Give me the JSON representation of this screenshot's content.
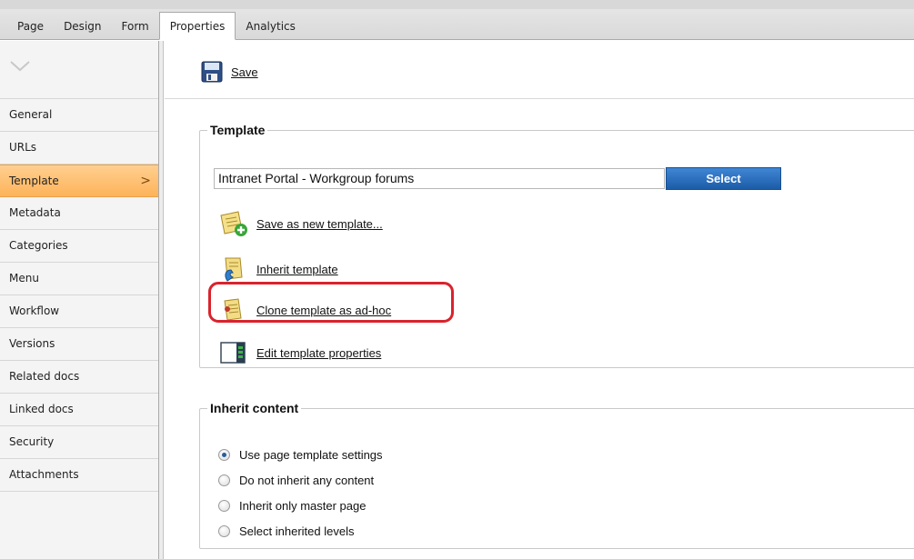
{
  "tabs": [
    {
      "label": "Page"
    },
    {
      "label": "Design"
    },
    {
      "label": "Form"
    },
    {
      "label": "Properties",
      "active": true
    },
    {
      "label": "Analytics"
    }
  ],
  "sidebar": {
    "collapse_icon": "chevron-down-icon",
    "items": [
      {
        "label": "General"
      },
      {
        "label": "URLs"
      },
      {
        "label": "Template",
        "active": true,
        "chevron": ">"
      },
      {
        "label": "Metadata"
      },
      {
        "label": "Categories"
      },
      {
        "label": "Menu"
      },
      {
        "label": "Workflow"
      },
      {
        "label": "Versions"
      },
      {
        "label": "Related docs"
      },
      {
        "label": "Linked docs"
      },
      {
        "label": "Security"
      },
      {
        "label": "Attachments"
      }
    ]
  },
  "toolbar": {
    "save_label": "Save",
    "save_icon": "floppy-disk-icon"
  },
  "template_section": {
    "title": "Template",
    "current_template": "Intranet Portal - Workgroup forums",
    "select_label": "Select",
    "actions": [
      {
        "label": "Save as new template...",
        "icon": "save-template-icon"
      },
      {
        "label": "Inherit template",
        "icon": "inherit-template-icon"
      },
      {
        "label": "Clone template as ad-hoc",
        "icon": "clone-template-icon",
        "highlighted": true
      },
      {
        "label": "Edit template properties",
        "icon": "edit-properties-icon"
      }
    ]
  },
  "inherit_section": {
    "title": "Inherit content",
    "options": [
      {
        "label": "Use page template settings",
        "checked": true
      },
      {
        "label": "Do not inherit any content",
        "checked": false
      },
      {
        "label": "Inherit only master page",
        "checked": false
      },
      {
        "label": "Select inherited levels",
        "checked": false
      }
    ]
  },
  "colors": {
    "active_item": "#fdb35a",
    "select_button": "#1c5ca8",
    "highlight": "#d9232d"
  }
}
